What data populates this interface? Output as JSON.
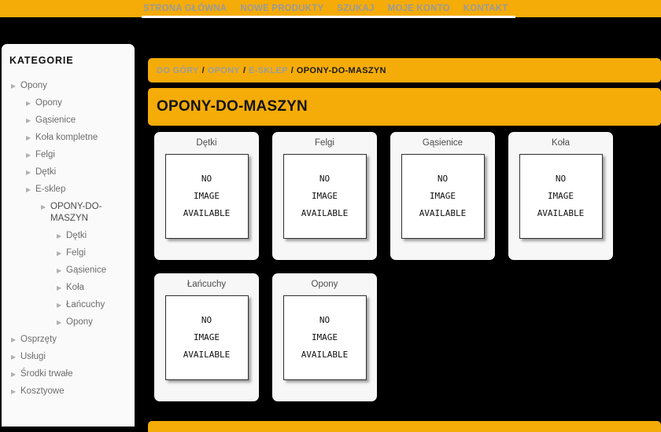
{
  "colors": {
    "accent_orange": "#F5AC08",
    "nav_text": "#9a9a9a",
    "page_bg": "#000000",
    "panel_bg": "#fafafa",
    "card_bg": "#f7f7f7"
  },
  "topnav": {
    "items": [
      {
        "label": "STRONA GŁÓWNA"
      },
      {
        "label": "NOWE PRODUKTY"
      },
      {
        "label": "SZUKAJ"
      },
      {
        "label": "MOJE KONTO"
      },
      {
        "label": "KONTAKT"
      }
    ]
  },
  "sidebar": {
    "title": "KATEGORIE",
    "arrow_icon": "▶",
    "items": [
      {
        "label": "Opony",
        "level": 1,
        "current": false
      },
      {
        "label": "Opony",
        "level": 2,
        "current": false
      },
      {
        "label": "Gąsienice",
        "level": 2,
        "current": false
      },
      {
        "label": "Koła kompletne",
        "level": 2,
        "current": false
      },
      {
        "label": "Felgi",
        "level": 2,
        "current": false
      },
      {
        "label": "Dętki",
        "level": 2,
        "current": false
      },
      {
        "label": "E-sklep",
        "level": 2,
        "current": false
      },
      {
        "label": "OPONY-DO-MASZYN",
        "level": 3,
        "current": true
      },
      {
        "label": "Dętki",
        "level": 4,
        "current": false
      },
      {
        "label": "Felgi",
        "level": 4,
        "current": false
      },
      {
        "label": "Gąsienice",
        "level": 4,
        "current": false
      },
      {
        "label": "Koła",
        "level": 4,
        "current": false
      },
      {
        "label": "Łańcuchy",
        "level": 4,
        "current": false
      },
      {
        "label": "Opony",
        "level": 4,
        "current": false
      },
      {
        "label": "Osprzęty",
        "level": 1,
        "current": false
      },
      {
        "label": "Usługi",
        "level": 1,
        "current": false
      },
      {
        "label": "Środki trwałe",
        "level": 1,
        "current": false
      },
      {
        "label": "Kosztyowe",
        "level": 1,
        "current": false
      }
    ]
  },
  "breadcrumb": {
    "separator": "/",
    "items": [
      {
        "label": "DO GÓRY",
        "current": false
      },
      {
        "label": "OPONY",
        "current": false
      },
      {
        "label": "E-SKLEP",
        "current": false
      },
      {
        "label": "OPONY-DO-MASZYN",
        "current": true
      }
    ]
  },
  "page": {
    "title": "OPONY-DO-MASZYN"
  },
  "products": {
    "placeholder_lines": [
      "NO",
      "IMAGE",
      "AVAILABLE"
    ],
    "items": [
      {
        "name": "Dętki"
      },
      {
        "name": "Felgi"
      },
      {
        "name": "Gąsienice"
      },
      {
        "name": "Koła"
      },
      {
        "name": "Łańcuchy"
      },
      {
        "name": "Opony"
      }
    ]
  }
}
